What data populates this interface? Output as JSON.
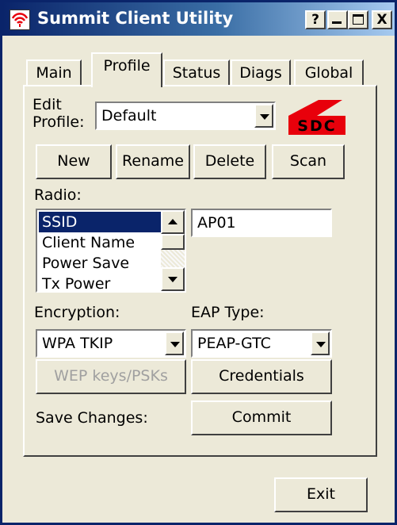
{
  "window": {
    "title": "Summit Client Utility",
    "help_label": "?",
    "minimize_label": "_",
    "maximize_label": "□",
    "close_label": "X"
  },
  "tabs": [
    {
      "label": "Main"
    },
    {
      "label": "Profile"
    },
    {
      "label": "Status"
    },
    {
      "label": "Diags"
    },
    {
      "label": "Global"
    }
  ],
  "active_tab": "Profile",
  "profile": {
    "edit_label_line1": "Edit",
    "edit_label_line2": "Profile:",
    "selected": "Default"
  },
  "logo": {
    "text": "SDC",
    "color": "#e8000b"
  },
  "buttons": {
    "new": "New",
    "rename": "Rename",
    "delete": "Delete",
    "scan": "Scan",
    "wep": "WEP keys/PSKs",
    "credentials": "Credentials",
    "commit": "Commit",
    "exit": "Exit"
  },
  "radio": {
    "label": "Radio:",
    "items": [
      "SSID",
      "Client Name",
      "Power Save",
      "Tx Power"
    ],
    "selected": "SSID",
    "value": "AP01"
  },
  "encryption": {
    "label": "Encryption:",
    "selected": "WPA TKIP"
  },
  "eap": {
    "label": "EAP Type:",
    "selected": "PEAP-GTC"
  },
  "save": {
    "label": "Save Changes:"
  },
  "colors": {
    "titlebar_start": "#0a246a",
    "titlebar_end": "#a6caf0",
    "face": "#ece9d8",
    "selection": "#0a246a"
  }
}
